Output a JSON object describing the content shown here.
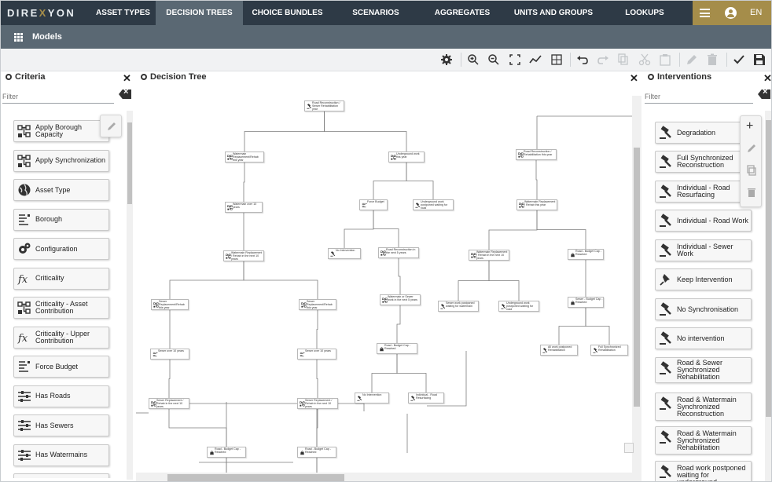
{
  "app": {
    "logo": "DIREXYON"
  },
  "nav": {
    "tabs": [
      {
        "label": "ASSET TYPES"
      },
      {
        "label": "DECISION TREES",
        "active": true
      },
      {
        "label": "CHOICE BUNDLES"
      },
      {
        "label": "SCENARIOS"
      },
      {
        "label": "AGGREGATES"
      },
      {
        "label": "UNITS AND GROUPS"
      },
      {
        "label": "LOOKUPS"
      }
    ],
    "language": "EN",
    "accent_color": "#a58d4a"
  },
  "subbar": {
    "title": "Models"
  },
  "toolbar": {
    "icons": [
      "gear-icon",
      "zoom-in-icon",
      "zoom-out-icon",
      "fit-screen-icon",
      "chart-line-icon",
      "grid-toggle-icon",
      "undo-icon",
      "redo-icon",
      "copy-icon",
      "cut-icon",
      "paste-icon",
      "edit-icon",
      "delete-icon",
      "check-icon",
      "save-icon"
    ]
  },
  "criteria": {
    "title": "Criteria",
    "filter_placeholder": "Filter",
    "items": [
      {
        "label": "Apply Borough Capacity",
        "icon": "tree-node-icon"
      },
      {
        "label": "Apply Synchronization",
        "icon": "tree-node-icon"
      },
      {
        "label": "Asset Type",
        "icon": "globe-icon"
      },
      {
        "label": "Borough",
        "icon": "list-icon"
      },
      {
        "label": "Configuration",
        "icon": "gears-icon"
      },
      {
        "label": "Criticality",
        "icon": "function-icon"
      },
      {
        "label": "Criticality - Asset Contribution",
        "icon": "tree-node-icon"
      },
      {
        "label": "Criticality - Upper Contribution",
        "icon": "function-icon"
      },
      {
        "label": "Force Budget",
        "icon": "list-icon"
      },
      {
        "label": "Has Roads",
        "icon": "sliders-icon"
      },
      {
        "label": "Has Sewers",
        "icon": "sliders-icon"
      },
      {
        "label": "Has Watermains",
        "icon": "sliders-icon"
      }
    ]
  },
  "tree": {
    "title": "Decision Tree",
    "nodes": [
      {
        "id": "n1",
        "text": "Road Reconstruction / Sewer Rehabilitation year",
        "icon": "gavel-icon"
      },
      {
        "id": "n2",
        "text": "Watermain Replacement/Rehab this year",
        "icon": "tree-node-icon"
      },
      {
        "id": "n3",
        "text": "Underground work this year",
        "icon": "tree-node-icon"
      },
      {
        "id": "n4",
        "text": "Road Reconstruction / Rehabilitation this year",
        "icon": "tree-node-icon"
      },
      {
        "id": "n5",
        "text": "Watermain over 10 years",
        "icon": "tree-node-icon"
      },
      {
        "id": "n6",
        "text": "Force Budget",
        "icon": "list-icon"
      },
      {
        "id": "n7",
        "text": "Underground work postponed waiting for road",
        "icon": "gavel-icon"
      },
      {
        "id": "n8",
        "text": "Watermain Replacement / Rehab this year",
        "icon": "tree-node-icon"
      },
      {
        "id": "n9",
        "text": "Watermain Replacement / Rehab in the next 10 years",
        "icon": "tree-node-icon"
      },
      {
        "id": "n10",
        "text": "No Intervention",
        "icon": "gavel-icon"
      },
      {
        "id": "n11",
        "text": "Road Reconstruction in the next 5 years",
        "icon": "tree-node-icon"
      },
      {
        "id": "n12",
        "text": "Watermain Replacement / Rehab in the next 10 years",
        "icon": "tree-node-icon"
      },
      {
        "id": "n13",
        "text": "Road - Budget Cap - Reached",
        "icon": "bag-icon"
      },
      {
        "id": "n14",
        "text": "Sewer Replacement/Rehab this year",
        "icon": "tree-node-icon"
      },
      {
        "id": "n15",
        "text": "Sewer Replacement/Rehab this year",
        "icon": "tree-node-icon"
      },
      {
        "id": "n16",
        "text": "Watermain or Sewer work in the next 5 years",
        "icon": "tree-node-icon"
      },
      {
        "id": "n17",
        "text": "Sewer work postponed waiting for watermain",
        "icon": "gavel-icon"
      },
      {
        "id": "n18",
        "text": "Underground work postponed waiting for road",
        "icon": "gavel-icon"
      },
      {
        "id": "n19",
        "text": "Sewer - Budget Cap - Reached",
        "icon": "bag-icon"
      },
      {
        "id": "n20",
        "text": "Sewer over 10 years",
        "icon": "list-icon"
      },
      {
        "id": "n21",
        "text": "Sewer over 10 years",
        "icon": "list-icon"
      },
      {
        "id": "n22",
        "text": "Road - Budget Cap - Reached",
        "icon": "bag-icon"
      },
      {
        "id": "n23",
        "text": "All work postponed Rehabilitation",
        "icon": "gavel-icon"
      },
      {
        "id": "n24",
        "text": "Full Synchronized Rehabilitation",
        "icon": "gavel-icon"
      },
      {
        "id": "n25",
        "text": "Sewer Replacement / Rehab in the next 10 years",
        "icon": "tree-node-icon"
      },
      {
        "id": "n26",
        "text": "Sewer Replacement / Rehab in the next 10 years",
        "icon": "tree-node-icon"
      },
      {
        "id": "n27",
        "text": "No Intervention",
        "icon": "gavel-icon"
      },
      {
        "id": "n28",
        "text": "Individual - Road Resurfacing",
        "icon": "gavel-icon"
      },
      {
        "id": "n29",
        "text": "Road - Budget Cap - Reached",
        "icon": "bag-icon"
      },
      {
        "id": "n30",
        "text": "Road - Budget Cap - Reached",
        "icon": "bag-icon"
      }
    ]
  },
  "interventions": {
    "title": "Interventions",
    "filter_placeholder": "Filter",
    "items": [
      {
        "label": "Degradation"
      },
      {
        "label": "Full Synchronized Reconstruction"
      },
      {
        "label": "Individual - Road Resurfacing"
      },
      {
        "label": "Individual - Road Work"
      },
      {
        "label": "Individual - Sewer Work"
      },
      {
        "label": "Keep Intervention",
        "icon": "pin-icon"
      },
      {
        "label": "No Synchronisation"
      },
      {
        "label": "No intervention"
      },
      {
        "label": "Road & Sewer Synchronized Rehabilitation"
      },
      {
        "label": "Road & Watermain Synchronized Reconstruction"
      },
      {
        "label": "Road & Watermain Synchronized Rehabilitation"
      },
      {
        "label": "Road work postponed waiting for underground"
      }
    ]
  }
}
